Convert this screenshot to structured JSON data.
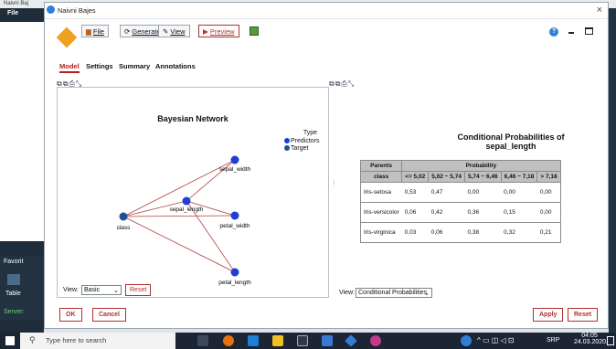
{
  "window": {
    "title": "Naivni Bajes",
    "close": "×"
  },
  "bg_app": {
    "title_fragment": "Naivni Baj",
    "menu_file": "File",
    "favorites": "Favorit",
    "table": "Table",
    "server": "Server:"
  },
  "toolbar": {
    "file_label": "File",
    "generate_label": "Generate",
    "view_label": "View",
    "preview_label": "Preview",
    "help": "?"
  },
  "tabs": [
    {
      "label": "Model",
      "active": true
    },
    {
      "label": "Settings",
      "active": false
    },
    {
      "label": "Summary",
      "active": false
    },
    {
      "label": "Annotations",
      "active": false
    }
  ],
  "left_pane": {
    "tool_icons": "⧉⧉⎙⤡",
    "title": "Bayesian Network",
    "legend": {
      "title": "Type",
      "items": [
        "Predictors",
        "Target"
      ]
    },
    "nodes": {
      "class": "class",
      "sepal_length": "sepal_length",
      "sepal_width": "sepal_width",
      "petal_width": "petal_width",
      "petal_length": "petal_length"
    },
    "view_label": "View:",
    "view_value": "Basic",
    "reset_label": "Reset"
  },
  "right_pane": {
    "tool_icons": "⧉⧉⎙⤡",
    "title_line1": "Conditional Probabilities  of",
    "title_line2": "sepal_length",
    "table": {
      "parents_header": "Parents",
      "probability_header": "Probability",
      "class_header": "class",
      "columns": [
        "<= 5,02",
        "5,02 ~ 5,74",
        "5,74 ~ 6,46",
        "6,46 ~ 7,18",
        "> 7,18"
      ],
      "rows": [
        {
          "label": "Iris-setosa",
          "values": [
            "0,53",
            "0,47",
            "0,00",
            "0,00",
            "0,00"
          ]
        },
        {
          "label": "Iris-versicolor",
          "values": [
            "0,06",
            "0,42",
            "0,36",
            "0,15",
            "0,00"
          ]
        },
        {
          "label": "Iris-virginica",
          "values": [
            "0,03",
            "0,06",
            "0,38",
            "0,32",
            "0,21"
          ]
        }
      ]
    },
    "view_label": "View:",
    "view_value": "Conditional Probabilities"
  },
  "footer": {
    "ok": "OK",
    "cancel": "Cancel",
    "apply": "Apply",
    "reset": "Reset"
  },
  "taskbar": {
    "search_placeholder": "Type here to search",
    "lang": "SRP",
    "time": "04:05",
    "date": "24.03.2020."
  },
  "colors": {
    "accent": "#b02020",
    "node": "#1f3ed6",
    "edge": "#b04040",
    "target": "#1f4f9a"
  }
}
